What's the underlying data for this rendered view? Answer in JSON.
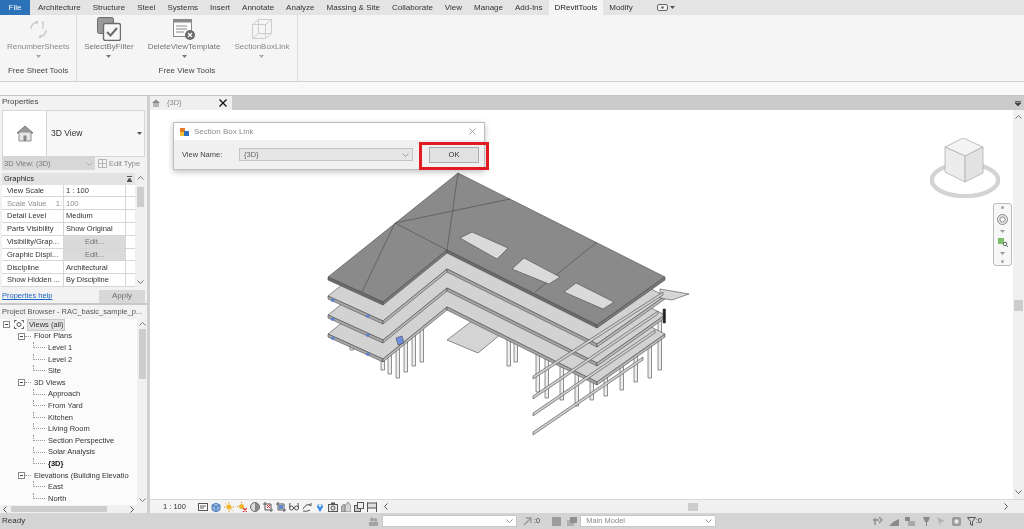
{
  "ribbon_tabs": [
    {
      "label": "File",
      "kind": "application",
      "selected": false
    },
    {
      "label": "Architecture",
      "kind": "tab",
      "selected": false
    },
    {
      "label": "Structure",
      "kind": "tab",
      "selected": false
    },
    {
      "label": "Steel",
      "kind": "tab",
      "selected": false
    },
    {
      "label": "Systems",
      "kind": "tab",
      "selected": false
    },
    {
      "label": "Insert",
      "kind": "tab",
      "selected": false
    },
    {
      "label": "Annotate",
      "kind": "tab",
      "selected": false
    },
    {
      "label": "Analyze",
      "kind": "tab",
      "selected": false
    },
    {
      "label": "Massing & Site",
      "kind": "tab",
      "selected": false
    },
    {
      "label": "Collaborate",
      "kind": "tab",
      "selected": false
    },
    {
      "label": "View",
      "kind": "tab",
      "selected": false
    },
    {
      "label": "Manage",
      "kind": "tab",
      "selected": false
    },
    {
      "label": "Add-Ins",
      "kind": "tab",
      "selected": false
    },
    {
      "label": "DRevitTools",
      "kind": "tab",
      "selected": true
    },
    {
      "label": "Modify",
      "kind": "tab",
      "selected": false
    }
  ],
  "ribbon_panels": [
    {
      "title": "Free Sheet Tools",
      "buttons": [
        {
          "label": "RenumberSheets",
          "kind": "renumber",
          "disabled": true
        }
      ]
    },
    {
      "title": "Free View Tools",
      "buttons": [
        {
          "label": "SelectByFilter",
          "kind": "filter",
          "disabled": false
        },
        {
          "label": "DeleteViewTemplate",
          "kind": "template",
          "disabled": false
        },
        {
          "label": "SectionBoxLink",
          "kind": "cube",
          "disabled": true
        }
      ]
    }
  ],
  "properties": {
    "title": "Properties",
    "type_name": "3D View",
    "instance_selector": {
      "value": "3D View: (3D)",
      "disabled": true
    },
    "edit_type": {
      "label": "Edit Type",
      "disabled": true
    },
    "group": "Graphics",
    "rows": [
      {
        "label": "View Scale",
        "value": "1 : 100",
        "kind": "text",
        "disabled": false
      },
      {
        "label": "Scale Value",
        "prefix": "1:",
        "value": "100",
        "kind": "text",
        "disabled": true
      },
      {
        "label": "Detail Level",
        "value": "Medium",
        "kind": "text",
        "disabled": false
      },
      {
        "label": "Parts Visibility",
        "value": "Show Original",
        "kind": "text",
        "disabled": false
      },
      {
        "label": "Visibility/Grap...",
        "value": "Edit...",
        "kind": "button",
        "disabled": false
      },
      {
        "label": "Graphic Displ...",
        "value": "Edit...",
        "kind": "button",
        "disabled": false
      },
      {
        "label": "Discipline",
        "value": "Architectural",
        "kind": "text",
        "disabled": false
      },
      {
        "label": "Show Hidden ...",
        "value": "By Discipline",
        "kind": "text",
        "disabled": false
      }
    ],
    "help_link": "Properties help",
    "apply": {
      "label": "Apply",
      "disabled": true
    }
  },
  "project_browser": {
    "title": "Project Browser - RAC_basic_sample_p...",
    "tree": [
      {
        "label": "Views (all)",
        "expanded": true,
        "selected": true,
        "current": false,
        "children": [
          {
            "label": "Floor Plans",
            "expanded": true,
            "selected": false,
            "current": false,
            "children": [
              {
                "label": "Level 1",
                "selected": false,
                "current": false
              },
              {
                "label": "Level 2",
                "selected": false,
                "current": false
              },
              {
                "label": "Site",
                "selected": false,
                "current": false
              }
            ]
          },
          {
            "label": "3D Views",
            "expanded": true,
            "selected": false,
            "current": false,
            "children": [
              {
                "label": "Approach",
                "selected": false,
                "current": false
              },
              {
                "label": "From Yard",
                "selected": false,
                "current": false
              },
              {
                "label": "Kitchen",
                "selected": false,
                "current": false
              },
              {
                "label": "Living Room",
                "selected": false,
                "current": false
              },
              {
                "label": "Section Perspective",
                "selected": false,
                "current": false
              },
              {
                "label": "Solar Analysis",
                "selected": false,
                "current": false
              },
              {
                "label": "{3D}",
                "selected": false,
                "current": true
              }
            ]
          },
          {
            "label": "Elevations (Building Elevatio",
            "expanded": true,
            "selected": false,
            "current": false,
            "children": [
              {
                "label": "East",
                "selected": false,
                "current": false
              },
              {
                "label": "North",
                "selected": false,
                "current": false
              }
            ]
          }
        ]
      }
    ]
  },
  "view_tab": {
    "label": "{3D}"
  },
  "dialog": {
    "title": "Section Box Link",
    "field_label": "View Name:",
    "field_value": "{3D}",
    "ok_label": "OK"
  },
  "view_control_bar": {
    "scale": "1 : 100"
  },
  "status_bar": {
    "message": "Ready",
    "counter_1": ":0",
    "design_option": "Main Model",
    "filter_counter": ":0"
  }
}
